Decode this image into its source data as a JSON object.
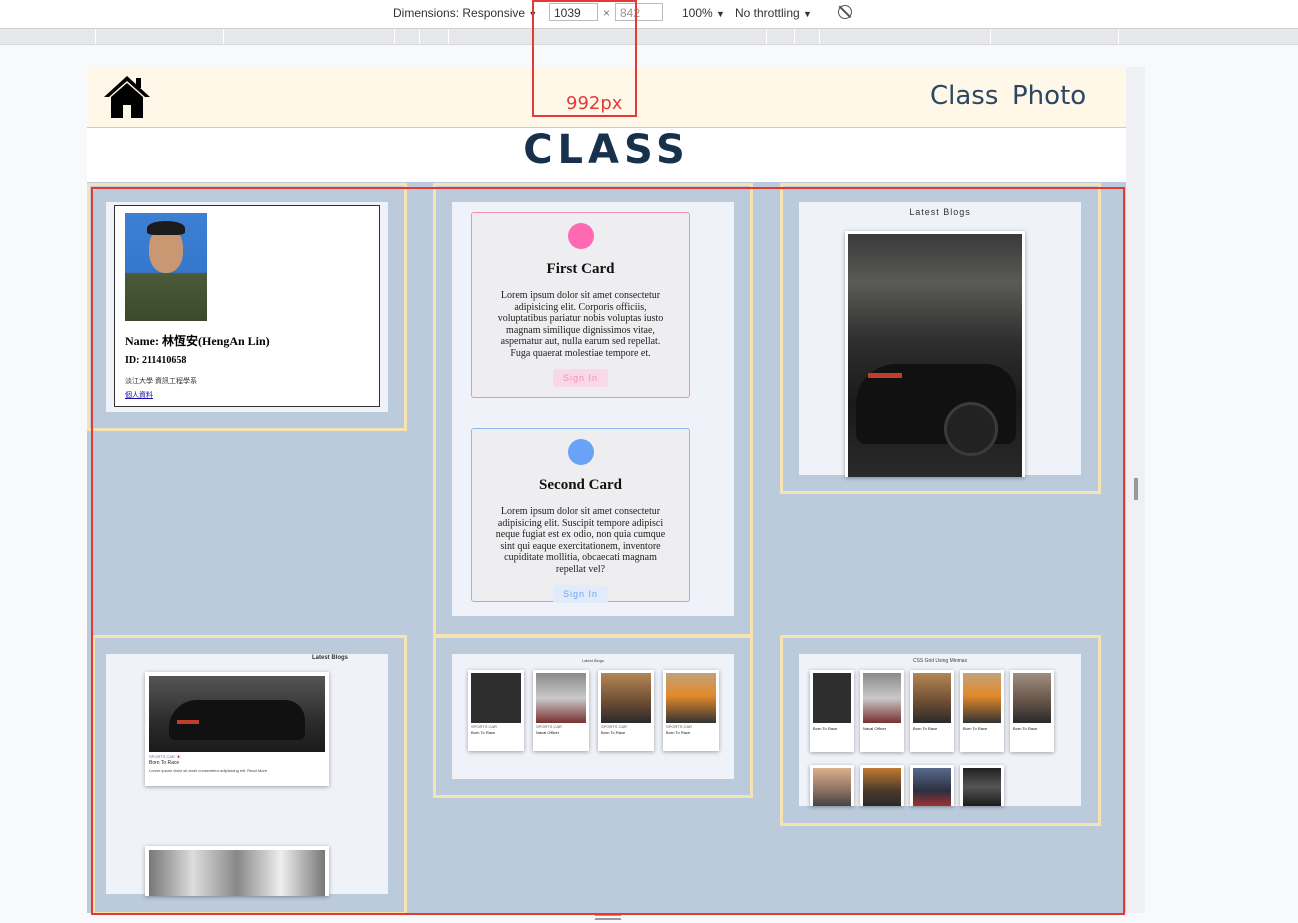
{
  "devtools": {
    "dimensions_label": "Dimensions: Responsive",
    "width_value": "1039",
    "times": "×",
    "height_value": "842",
    "zoom": "100%",
    "throttle": "No throttling",
    "dropdown_glyph": "▼",
    "breakpoint_label": "992px"
  },
  "nav": {
    "home_icon": "home-icon",
    "links": [
      "Class",
      "Photo"
    ]
  },
  "page_title": "CLASS",
  "profile": {
    "name": "Name: 林恆安(HengAn Lin)",
    "id": "ID: 211410658",
    "dept": "淡江大學 資訊工程學系",
    "link": "個人資料"
  },
  "cards": [
    {
      "title": "First Card",
      "text": "Lorem ipsum dolor sit amet consectetur adipisicing elit. Corporis officiis, voluptatibus pariatur nobis voluptas iusto magnam similique dignissimos vitae, aspernatur aut, nulla earum sed repellat. Fuga quaerat molestiae tempore et.",
      "button": "Sign In",
      "accent": "#ff69b4"
    },
    {
      "title": "Second Card",
      "text": "Lorem ipsum dolor sit amet consectetur adipisicing elit. Suscipit tempore adipisci neque fugiat est ex odio, non quia cumque sint qui eaque exercitationem, inventore cupiditate mollitia, obcaecati magnam repellat vel?",
      "button": "Sign In",
      "accent": "#6aa2f8"
    }
  ],
  "blogs": {
    "latest_title": "Latest Blogs",
    "latest_title_2": "Latest Blogs",
    "latest_title_3": "Latest Blogs",
    "grid_title": "CSS Grid Using Minmax",
    "tag": "SPORTS CAR 🇯🇵",
    "headline": "Born To Race",
    "excerpt": "Lorem ipsum dolor sit amet consectetur adipisicing elit. Read More",
    "small_cards": [
      {
        "tag": "SPORTS CAR",
        "headline": "Born To Race"
      },
      {
        "tag": "SPORTS CAR",
        "headline": "Naval Officer"
      },
      {
        "tag": "SPORTS CAR",
        "headline": "Born To Race"
      },
      {
        "tag": "SPORTS CAR",
        "headline": "Born To Race"
      }
    ],
    "grid_cards": [
      {
        "headline": "Born To Race"
      },
      {
        "headline": "Naval Officer"
      },
      {
        "headline": "Born To Race"
      },
      {
        "headline": "Born To Race"
      },
      {
        "headline": "Born To Race"
      }
    ],
    "read_more": "Read More"
  },
  "colors": {
    "page_bg": "#bccbdc",
    "frame": "#f6e3b2",
    "nav_bg": "#fff8e8",
    "title": "#17314d",
    "highlight": "#e53935"
  }
}
